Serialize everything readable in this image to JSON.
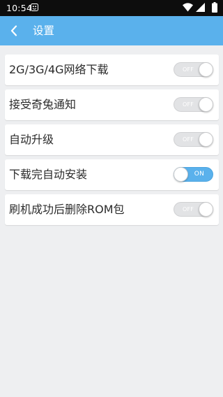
{
  "status_bar": {
    "time": "10:54",
    "app_icon": "notification-app-icon",
    "icons": [
      "wifi-icon",
      "cell-signal-icon",
      "battery-icon"
    ]
  },
  "app_bar": {
    "title": "设置",
    "back_icon": "chevron-left-icon",
    "color": "#5ab1ec"
  },
  "settings": [
    {
      "label": "2G/3G/4G网络下载",
      "state": "OFF",
      "enabled": false
    },
    {
      "label": "接受奇兔通知",
      "state": "OFF",
      "enabled": false
    },
    {
      "label": "自动升级",
      "state": "OFF",
      "enabled": false
    },
    {
      "label": "下载完自动安装",
      "state": "ON",
      "enabled": true
    },
    {
      "label": "刷机成功后删除ROM包",
      "state": "OFF",
      "enabled": false
    }
  ]
}
